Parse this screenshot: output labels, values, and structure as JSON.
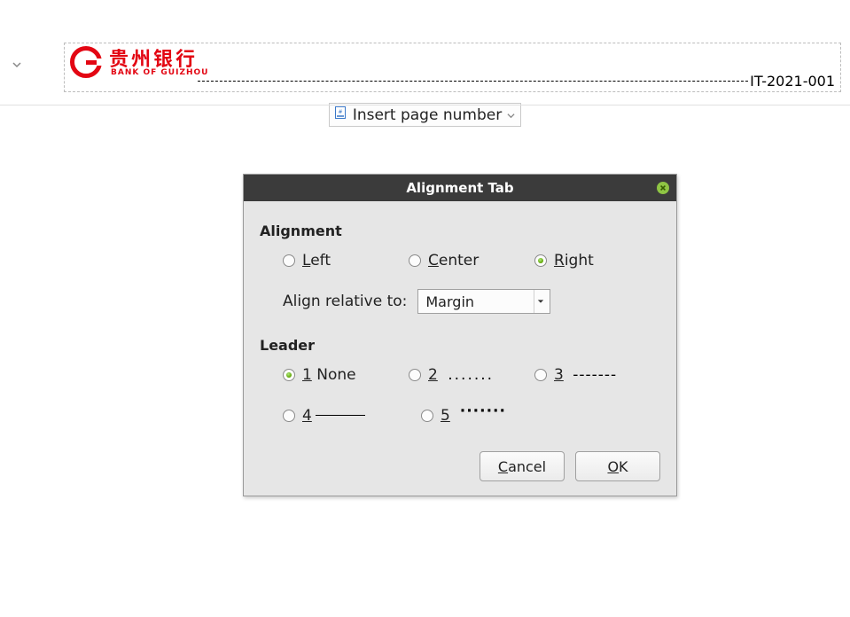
{
  "header": {
    "logo_cn": "贵州银行",
    "logo_en": "BANK OF GUIZHOU",
    "doc_number": "IT-2021-001"
  },
  "insert_btn": {
    "label": "Insert page number"
  },
  "dialog": {
    "title": "Alignment Tab",
    "sections": {
      "alignment_label": "Alignment",
      "leader_label": "Leader"
    },
    "alignment": {
      "options": [
        {
          "mn": "L",
          "rest": "eft",
          "selected": false
        },
        {
          "mn": "C",
          "rest": "enter",
          "selected": false
        },
        {
          "mn": "R",
          "rest": "ight",
          "selected": true
        }
      ],
      "relative_label": "Align relative to:",
      "relative_value": "Margin"
    },
    "leader": {
      "options": [
        {
          "mn": "1",
          "text": " None",
          "selected": true
        },
        {
          "mn": "2",
          "vis": "dots",
          "selected": false
        },
        {
          "mn": "3",
          "vis": "dash",
          "selected": false
        },
        {
          "mn": "4",
          "vis": "under",
          "selected": false
        },
        {
          "mn": "5",
          "vis": "middots",
          "selected": false
        }
      ]
    },
    "buttons": {
      "cancel_mn": "C",
      "cancel_rest": "ancel",
      "ok_mn": "O",
      "ok_rest": "K"
    }
  }
}
